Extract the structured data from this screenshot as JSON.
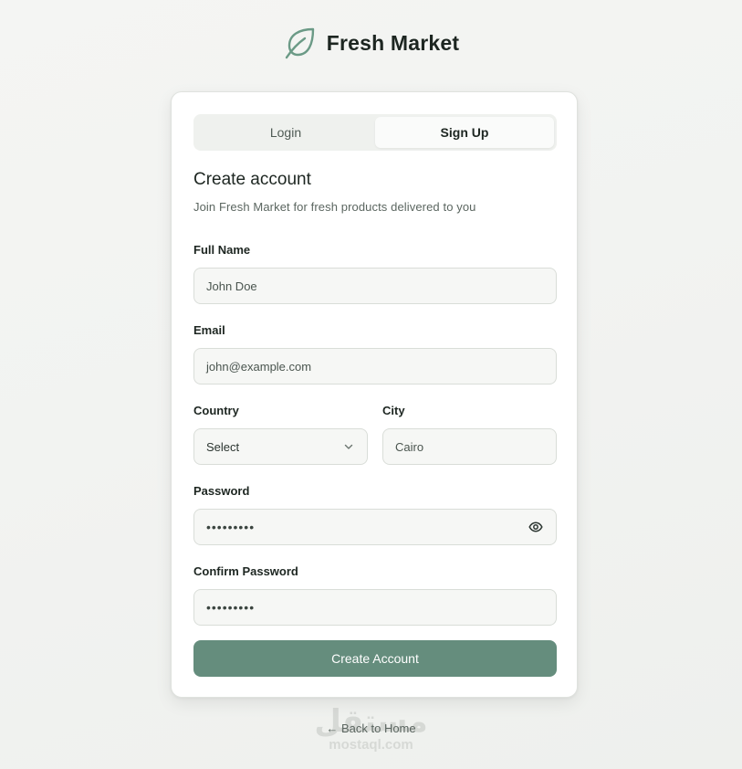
{
  "brand": {
    "name": "Fresh Market",
    "logo_icon": "leaf-icon",
    "logo_color": "#6b9a86"
  },
  "tabs": [
    {
      "label": "Login",
      "active": false
    },
    {
      "label": "Sign Up",
      "active": true
    }
  ],
  "form": {
    "title": "Create account",
    "subtitle": "Join Fresh Market for fresh products delivered to you",
    "full_name": {
      "label": "Full Name",
      "value": "John Doe"
    },
    "email": {
      "label": "Email",
      "value": "john@example.com"
    },
    "country": {
      "label": "Country",
      "value": "Select"
    },
    "city": {
      "label": "City",
      "value": "Cairo"
    },
    "password": {
      "label": "Password",
      "value": "•••••••••"
    },
    "confirm_password": {
      "label": "Confirm Password",
      "value": "•••••••••"
    },
    "submit_label": "Create Account",
    "accent_color": "#658d7d"
  },
  "back_link": "← Back to Home",
  "watermark": {
    "arabic": "مستقل",
    "latin": "mostaql.com"
  }
}
